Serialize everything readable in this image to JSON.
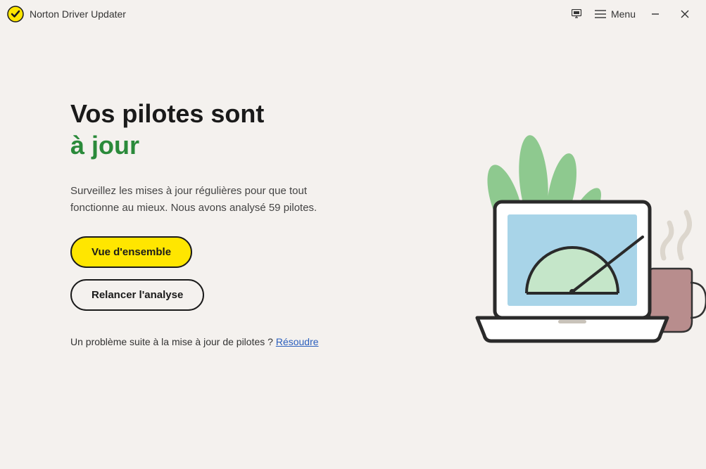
{
  "app": {
    "title": "Norton Driver Updater",
    "menu_label": "Menu"
  },
  "headline": {
    "line1": "Vos pilotes sont",
    "line2": "à jour"
  },
  "subtext": "Surveillez les mises à jour régulières pour que tout fonctionne au mieux. Nous avons analysé 59 pilotes.",
  "buttons": {
    "overview": "Vue d'ensemble",
    "rescan": "Relancer l'analyse"
  },
  "problem": {
    "text": "Un problème suite à la mise à jour de pilotes ? ",
    "link": "Résoudre"
  },
  "colors": {
    "accent_green": "#2a8a3a",
    "accent_yellow": "#ffe600",
    "link_blue": "#2b5fbd"
  }
}
